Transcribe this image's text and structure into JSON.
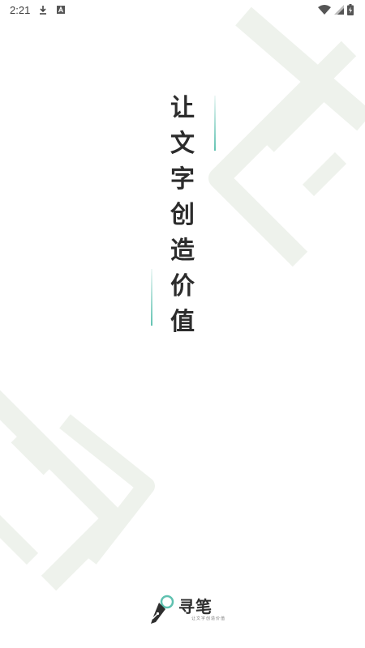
{
  "status_bar": {
    "time": "2:21",
    "left_icons": [
      "download-icon",
      "a-letter-icon"
    ],
    "right_icons": [
      "wifi-icon",
      "signal-icon",
      "battery-charging-icon"
    ]
  },
  "slogan": {
    "chars": [
      "让",
      "文",
      "字",
      "创",
      "造",
      "价",
      "值"
    ]
  },
  "brand": {
    "name": "寻笔",
    "tagline": "让文字创造价值",
    "logo_icon": "pen-nib-icon"
  },
  "colors": {
    "accent": "#5fc1b0",
    "background": "#ffffff",
    "watermark": "#eef2ec",
    "text": "#2c2c2c"
  }
}
